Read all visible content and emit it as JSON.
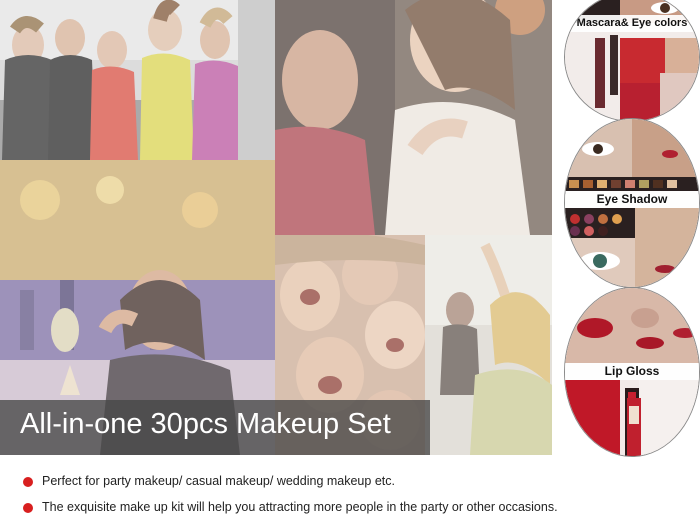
{
  "banner": {
    "title": "All-in-one 30pcs Makeup Set"
  },
  "feature_ovals": [
    {
      "label": "Mascara& Eye colors"
    },
    {
      "label": "Eye Shadow"
    },
    {
      "label": "Lip Gloss"
    }
  ],
  "features": [
    "Perfect for party makeup/ casual makeup/ wedding makeup etc.",
    "The exquisite make up kit will help you attracting more people in the party or other occasions."
  ],
  "colors": {
    "bullet": "#d81f1f",
    "title_band": "#464646",
    "title_text": "#ffffff"
  }
}
